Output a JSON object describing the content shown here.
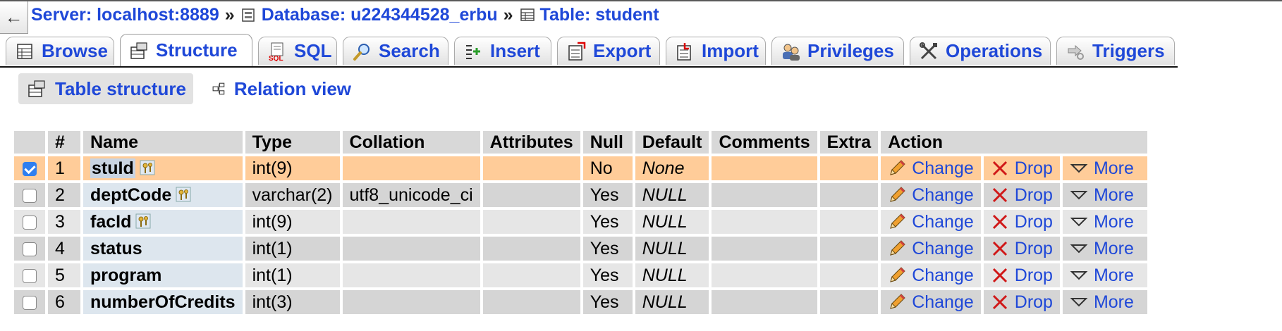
{
  "breadcrumb": {
    "server": "Server: localhost:8889",
    "database": "Database: u224344528_erbu",
    "table": "Table: student",
    "separator": "»"
  },
  "back_symbol": "←",
  "tabs": [
    {
      "label": "Browse",
      "icon": "browse-icon"
    },
    {
      "label": "Structure",
      "icon": "structure-icon",
      "active": true
    },
    {
      "label": "SQL",
      "icon": "sql-icon"
    },
    {
      "label": "Search",
      "icon": "search-icon"
    },
    {
      "label": "Insert",
      "icon": "insert-icon"
    },
    {
      "label": "Export",
      "icon": "export-icon"
    },
    {
      "label": "Import",
      "icon": "import-icon"
    },
    {
      "label": "Privileges",
      "icon": "privileges-icon"
    },
    {
      "label": "Operations",
      "icon": "operations-icon"
    },
    {
      "label": "Triggers",
      "icon": "triggers-icon"
    }
  ],
  "subtabs": [
    {
      "label": "Table structure",
      "icon": "table-structure-icon",
      "active": true
    },
    {
      "label": "Relation view",
      "icon": "relation-view-icon"
    }
  ],
  "table": {
    "headers": [
      "#",
      "Name",
      "Type",
      "Collation",
      "Attributes",
      "Null",
      "Default",
      "Comments",
      "Extra",
      "Action"
    ],
    "actions": {
      "change": "Change",
      "drop": "Drop",
      "more": "More"
    },
    "rows": [
      {
        "num": "1",
        "name": "stuId",
        "type": "int(9)",
        "collation": "",
        "attributes": "",
        "null": "No",
        "default": "None",
        "comments": "",
        "extra": "",
        "checked": true,
        "key": "primary"
      },
      {
        "num": "2",
        "name": "deptCode",
        "type": "varchar(2)",
        "collation": "utf8_unicode_ci",
        "attributes": "",
        "null": "Yes",
        "default": "NULL",
        "comments": "",
        "extra": "",
        "checked": false,
        "key": "index"
      },
      {
        "num": "3",
        "name": "facId",
        "type": "int(9)",
        "collation": "",
        "attributes": "",
        "null": "Yes",
        "default": "NULL",
        "comments": "",
        "extra": "",
        "checked": false,
        "key": "index"
      },
      {
        "num": "4",
        "name": "status",
        "type": "int(1)",
        "collation": "",
        "attributes": "",
        "null": "Yes",
        "default": "NULL",
        "comments": "",
        "extra": "",
        "checked": false,
        "key": ""
      },
      {
        "num": "5",
        "name": "program",
        "type": "int(1)",
        "collation": "",
        "attributes": "",
        "null": "Yes",
        "default": "NULL",
        "comments": "",
        "extra": "",
        "checked": false,
        "key": ""
      },
      {
        "num": "6",
        "name": "numberOfCredits",
        "type": "int(3)",
        "collation": "",
        "attributes": "",
        "null": "Yes",
        "default": "NULL",
        "comments": "",
        "extra": "",
        "checked": false,
        "key": ""
      }
    ]
  },
  "colors": {
    "link": "#1f48d8",
    "marked_row": "#ffcc99",
    "header_bg": "#d8d8d8"
  }
}
